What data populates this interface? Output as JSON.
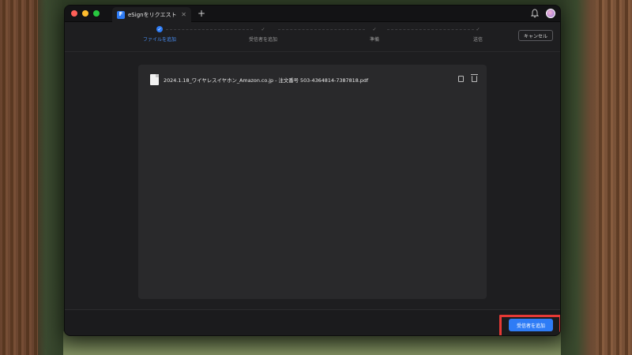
{
  "window": {
    "tab_title": "eSignをリクエスト",
    "tab_icon_letter": "F",
    "new_tab_glyph": "+",
    "close_glyph": "✕"
  },
  "steps": [
    {
      "label": "ファイルを追加",
      "state": "active",
      "glyph": "✓"
    },
    {
      "label": "受信者を追加",
      "state": "idle",
      "glyph": "✓"
    },
    {
      "label": "準備",
      "state": "idle",
      "glyph": "✓"
    },
    {
      "label": "送信",
      "state": "idle",
      "glyph": "✓"
    }
  ],
  "header": {
    "cancel_label": "キャンセル"
  },
  "files": [
    {
      "name": "2024.1.18_ワイヤレスイヤホン_Amazon.co.jp - 注文番号 503-4364814-7387818.pdf"
    }
  ],
  "footer": {
    "primary_label": "受信者を追加"
  },
  "colors": {
    "accent": "#2e7cf6",
    "highlight_box": "#e53935"
  },
  "icons": {
    "file": "pdf-file-icon",
    "copy": "copy-icon",
    "delete": "trash-icon",
    "notification": "bell-icon",
    "profile": "avatar"
  }
}
